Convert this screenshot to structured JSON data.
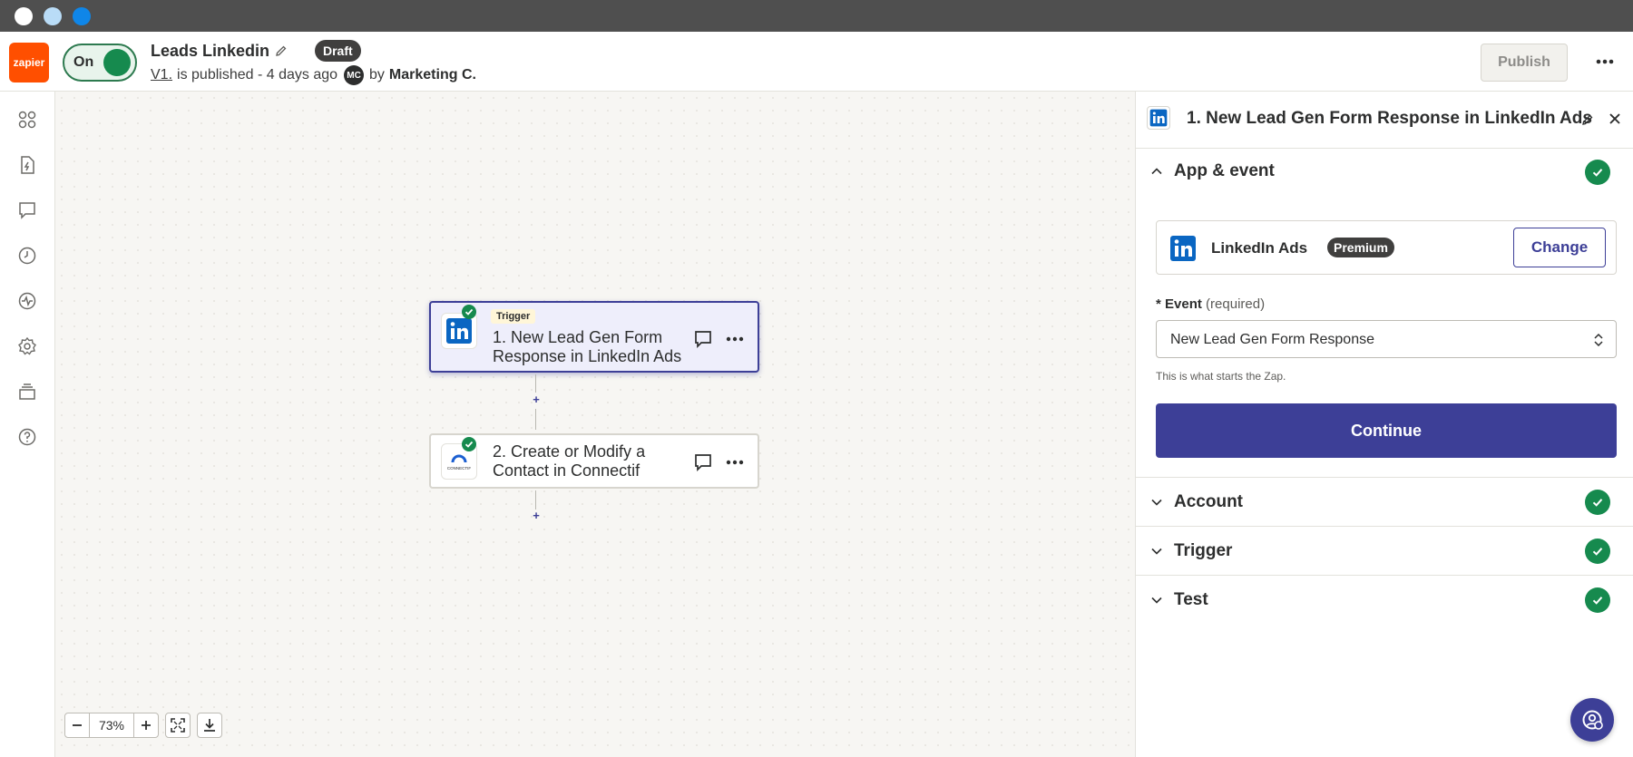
{
  "header": {
    "logo_text": "zapier",
    "toggle_label": "On",
    "zap_title": "Leads Linkedin",
    "status_badge": "Draft",
    "version_link": "V1.",
    "published_text": "is published - 4 days ago",
    "avatar_initials": "MC",
    "by_label": "by",
    "author": "Marketing C.",
    "publish_label": "Publish"
  },
  "sidebar": {
    "icons": [
      "apps-icon",
      "zap-file-icon",
      "comment-icon",
      "history-icon",
      "activity-icon",
      "settings-icon",
      "versions-icon",
      "help-icon"
    ]
  },
  "canvas": {
    "steps": [
      {
        "tag": "Trigger",
        "title": "1. New Lead Gen Form Response in LinkedIn Ads",
        "app_icon": "linkedin-icon"
      },
      {
        "title": "2. Create or Modify a Contact in Connectif",
        "app_icon": "connectif-icon",
        "app_icon_text": "CONNECTIF"
      }
    ],
    "zoom": {
      "value": "73%"
    }
  },
  "panel": {
    "title": "1. New Lead Gen Form Response in LinkedIn Ads",
    "sections": {
      "app_event": "App & event",
      "account": "Account",
      "trigger": "Trigger",
      "test": "Test"
    },
    "app": {
      "name": "LinkedIn Ads",
      "badge": "Premium",
      "change_label": "Change"
    },
    "event": {
      "required_marker": "*",
      "label": "Event",
      "required_text": "(required)",
      "value": "New Lead Gen Form Response",
      "help": "This is what starts the Zap."
    },
    "continue_label": "Continue"
  },
  "colors": {
    "brand": "#ff4f00",
    "accent": "#3d3f97",
    "success": "#168a4e",
    "linkedin": "#0a66c2"
  }
}
